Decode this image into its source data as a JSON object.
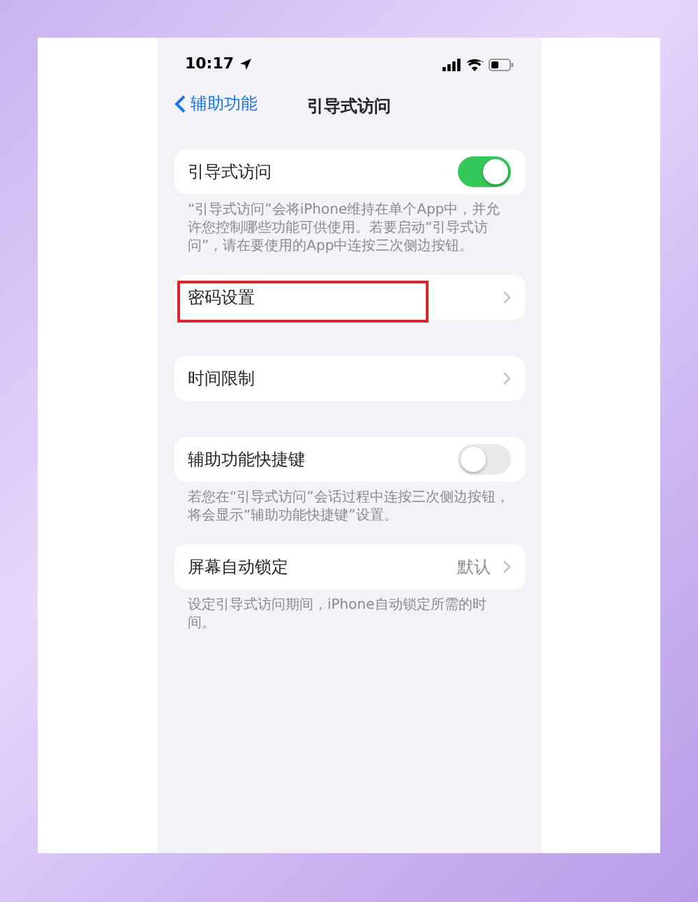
{
  "status_bar": {
    "time": "10:17"
  },
  "nav": {
    "back_label": "辅助功能",
    "title": "引导式访问"
  },
  "groups": [
    {
      "rows": [
        {
          "kind": "toggle",
          "label": "引导式访问",
          "on": true
        }
      ],
      "footer": "“引导式访问”会将iPhone维持在单个App中，并允许您控制哪些功能可供使用。若要启动“引导式访问”，请在要使用的App中连按三次侧边按钮。"
    },
    {
      "rows": [
        {
          "kind": "link",
          "label": "密码设置",
          "highlighted": true
        }
      ]
    },
    {
      "rows": [
        {
          "kind": "link",
          "label": "时间限制",
          "highlighted": false
        }
      ]
    },
    {
      "rows": [
        {
          "kind": "toggle",
          "label": "辅助功能快捷键",
          "on": false
        }
      ],
      "footer": "若您在“引导式访问”会话过程中连按三次侧边按钮，将会显示“辅助功能快捷键”设置。"
    },
    {
      "rows": [
        {
          "kind": "link",
          "label": "屏幕自动锁定",
          "value": "默认",
          "highlighted": false
        }
      ],
      "footer": "设定引导式访问期间，iPhone自动锁定所需的时间。"
    }
  ]
}
